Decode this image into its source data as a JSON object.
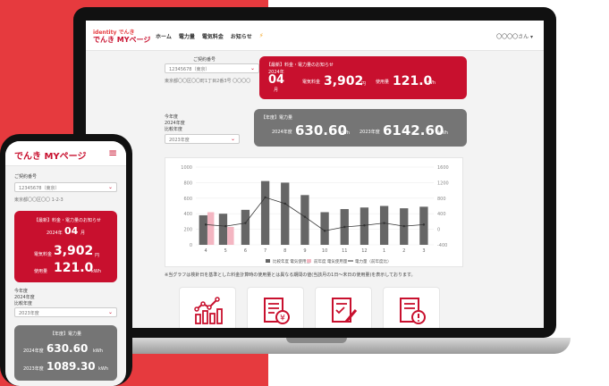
{
  "brand": {
    "logo_top": "identity でんき",
    "logo_main": "でんき MYページ",
    "accent": "#c8102e",
    "red_bg": "#e63a3e"
  },
  "nav": {
    "items": [
      "ホーム",
      "電力量",
      "電気料金",
      "お知らせ"
    ],
    "user": "〇〇〇〇さん"
  },
  "contract": {
    "label": "ご契約番号",
    "number": "12345678（東京）",
    "address": "東京都〇〇区〇〇町1丁目2番3号 〇〇〇〇"
  },
  "notice": {
    "title": "【最新】料金・電力量のお知らせ",
    "year": "2024年",
    "month": "04",
    "month_unit": "月",
    "fee_label": "電気料金",
    "fee_value": "3,902",
    "fee_unit": "円",
    "usage_label": "使用量",
    "usage_value": "121.0",
    "usage_unit": "kWh"
  },
  "year_select": {
    "label1": "今年度",
    "label2": "2024年度",
    "label3": "比較年度",
    "value": "2023年度"
  },
  "annual": {
    "title": "【年度】電力量",
    "y1_label": "2024年度",
    "y1_value": "630.60",
    "y1_unit": "kWh",
    "y2_label": "2023年度",
    "y2_value": "6142.60",
    "y2_unit": "kWh"
  },
  "chart_data": {
    "type": "bar",
    "categories": [
      "4",
      "5",
      "6",
      "7",
      "8",
      "9",
      "10",
      "11",
      "12",
      "1",
      "2",
      "3"
    ],
    "series": [
      {
        "name": "比較年度 電気使用量",
        "values": [
          380,
          400,
          450,
          820,
          800,
          640,
          420,
          460,
          480,
          500,
          470,
          490
        ],
        "color": "#666666"
      },
      {
        "name": "前年度 電気使用量",
        "values": [
          420,
          230,
          0,
          0,
          0,
          0,
          0,
          0,
          0,
          0,
          0,
          0
        ],
        "color": "#f4b6c2"
      },
      {
        "name": "電力量（前年度比）",
        "values": [
          120,
          80,
          160,
          820,
          660,
          320,
          -40,
          60,
          100,
          160,
          80,
          120
        ],
        "color": "#333333"
      }
    ],
    "ylim": [
      0,
      1000
    ],
    "y2lim": [
      -400,
      1600
    ],
    "yticks": [
      "0",
      "200",
      "400",
      "600",
      "800",
      "1000"
    ],
    "y2ticks": [
      "-400",
      "0",
      "400",
      "800",
      "1200",
      "1600"
    ]
  },
  "note": "※当グラフは検針日を基準とした料金計算時の使用量とは異なる期間の値(当該月の1日〜末日の使用量)を表示しております。",
  "phone": {
    "logo": "でんき MYページ",
    "contract_label": "ご契約番号",
    "contract_number": "12345678（東京）",
    "address": "東京都〇〇区〇〇 1-2-3",
    "notice_title": "【最新】料金・電力量のお知らせ",
    "notice_month_label": "2024年",
    "notice_month": "04",
    "notice_month_unit": "月",
    "fee_label": "電気料金",
    "fee_value": "3,902",
    "fee_unit": "円",
    "usage_label": "使用量",
    "usage_value": "121.0",
    "usage_unit": "kWh",
    "year_label1": "今年度",
    "year_label2": "2024年度",
    "year_label3": "比較年度",
    "year_value": "2023年度",
    "annual_title": "【年度】電力量",
    "y1_label": "2024年度",
    "y1_value": "630.60",
    "y1_unit": "kWh",
    "y2_label": "2023年度",
    "y2_value": "1089.30",
    "y2_unit": "kWh"
  }
}
